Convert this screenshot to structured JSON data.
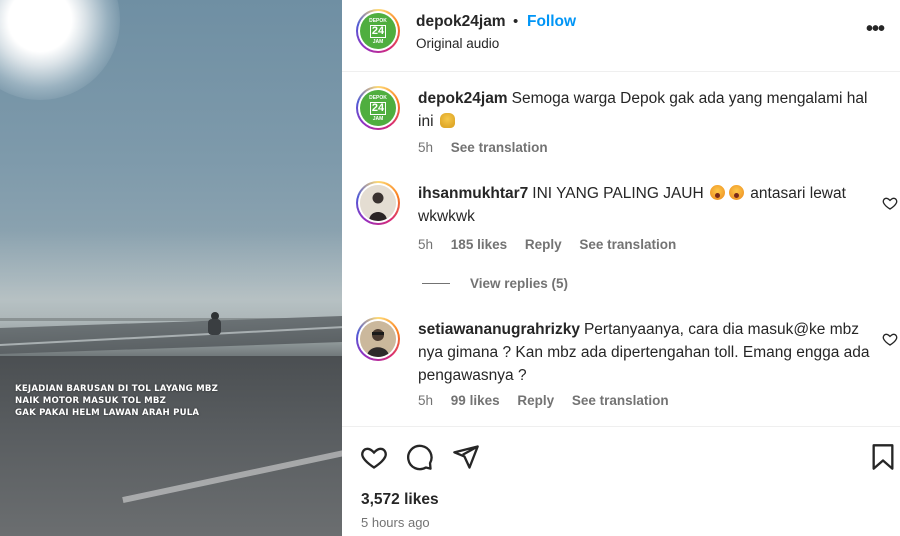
{
  "video": {
    "caption_lines": [
      "KEJADIAN BARUSAN DI TOL LAYANG MBZ",
      "NAIK MOTOR MASUK TOL MBZ",
      "GAK PAKAI HELM LAWAN ARAH PULA"
    ]
  },
  "header": {
    "username": "depok24jam",
    "separator": "•",
    "follow_label": "Follow",
    "audio": "Original audio",
    "more_label": "•••",
    "logo_top": "DEPOK",
    "logo_mid": "24",
    "logo_bottom": "JAM"
  },
  "caption_post": {
    "username": "depok24jam",
    "text": "Semoga warga Depok gak ada yang mengalami hal ini",
    "emoji": "pray",
    "time": "5h",
    "see_translation": "See translation"
  },
  "comments": [
    {
      "username": "ihsanmukhtar7",
      "text_before": "INI YANG PALING JAUH",
      "emojis": [
        "scream",
        "scream"
      ],
      "text_after": "antasari lewat wkwkwk",
      "time": "5h",
      "likes": "185 likes",
      "reply": "Reply",
      "see_translation": "See translation",
      "view_replies": "View replies (5)"
    },
    {
      "username": "setiawananugrahrizky",
      "text": "Pertanyaanya, cara dia masuk@ke mbz nya gimana ? Kan mbz ada dipertengahan toll. Emang engga ada pengawasnya ?",
      "time": "5h",
      "likes": "99 likes",
      "reply": "Reply",
      "see_translation": "See translation"
    }
  ],
  "actions": {
    "icons": [
      "heart-icon",
      "comment-icon",
      "share-icon",
      "bookmark-icon"
    ],
    "likes_count": "3,572 likes",
    "posted": "5 hours ago"
  },
  "colors": {
    "link_blue": "#0095f6",
    "brand_green": "#4fae3f",
    "muted_text": "#737373"
  }
}
